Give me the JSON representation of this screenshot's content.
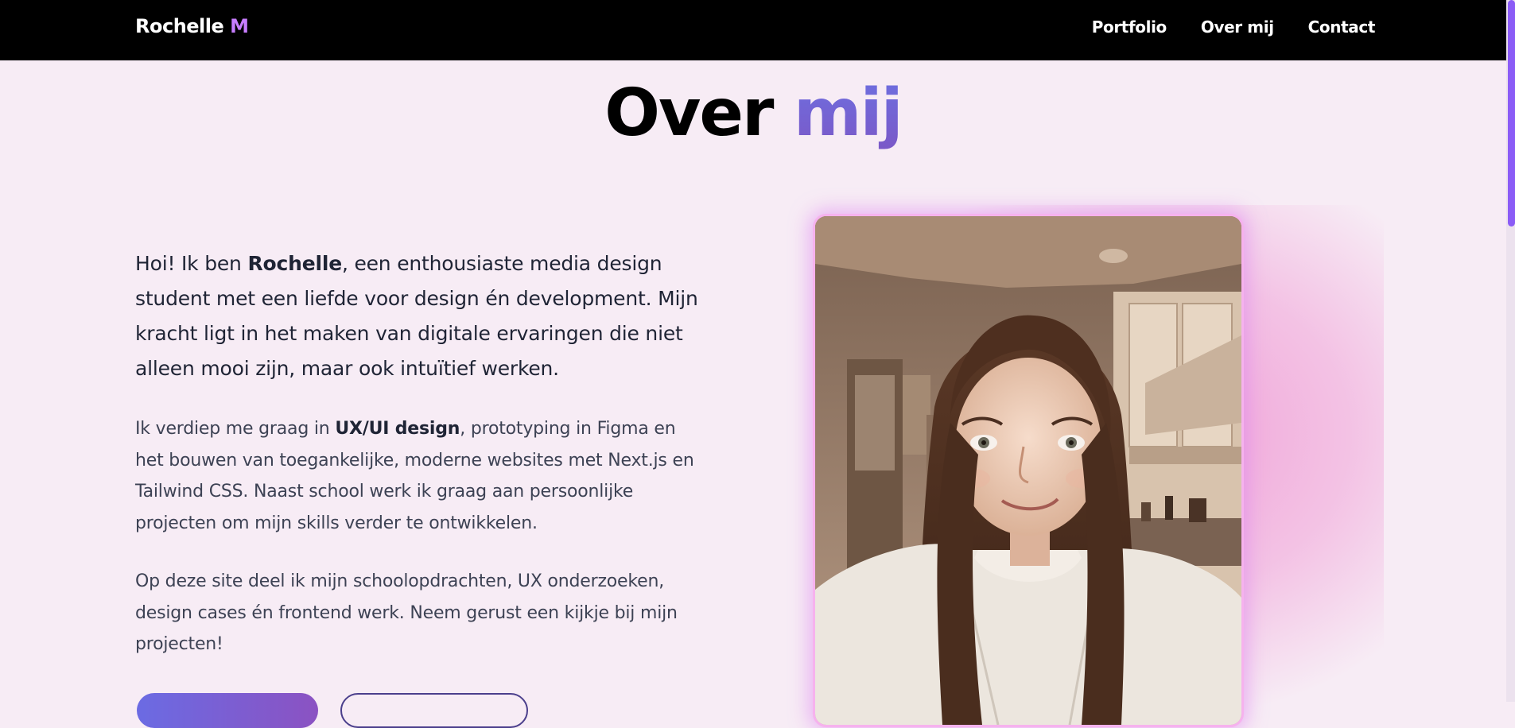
{
  "nav": {
    "brand_name": "Rochelle",
    "brand_accent": "M",
    "links": [
      "Portfolio",
      "Over mij",
      "Contact"
    ]
  },
  "about": {
    "title_main": "Over",
    "title_accent": "mij",
    "intro": {
      "prefix": "Hoi! Ik ben ",
      "name": "Rochelle",
      "suffix": ", een enthousiaste media design student met een liefde voor design én development. Mijn kracht ligt in het maken van digitale ervaringen die niet alleen mooi zijn, maar ook intuïtief werken."
    },
    "paragraph2": {
      "prefix": "Ik verdiep me graag in ",
      "highlight": "UX/UI design",
      "suffix": ", prototyping in Figma en het bouwen van toegankelijke, moderne websites met Next.js en Tailwind CSS. Naast school werk ik graag aan persoonlijke projecten om mijn skills verder te ontwikkelen."
    },
    "paragraph3": "Op deze site deel ik mijn schoolopdrachten, UX onderzoeken, design cases én frontend werk. Neem gerust een kijkje bij mijn projecten!",
    "photo_alt": "Rochelle"
  },
  "colors": {
    "nav_background": "#000000",
    "page_background": "#f7ecf5",
    "accent_purple": "#c77dff",
    "title_gradient_start": "#6d6fe0",
    "title_gradient_end": "#7b58c7",
    "photo_glow": "#f0a0d7",
    "scrollbar": "#8b5cf6"
  }
}
